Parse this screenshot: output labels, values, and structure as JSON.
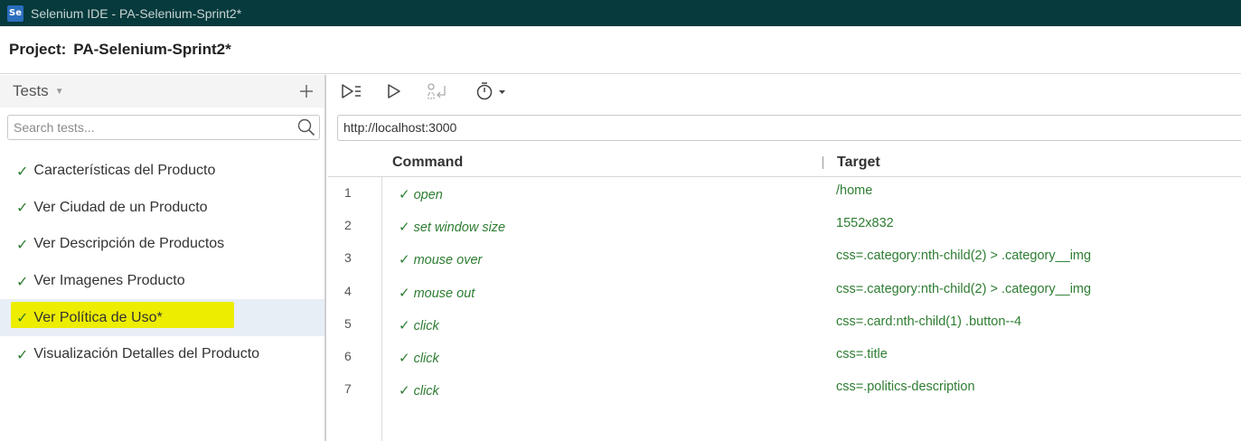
{
  "window": {
    "logo": "Se",
    "title": "Selenium IDE - PA-Selenium-Sprint2*"
  },
  "project": {
    "label": "Project:",
    "name": "PA-Selenium-Sprint2*"
  },
  "sidebar": {
    "title": "Tests",
    "add_icon": "plus-icon",
    "search_placeholder": "Search tests...",
    "check_mark": "✓",
    "tests": [
      {
        "label": "Características del Producto",
        "status": "passed"
      },
      {
        "label": "Ver Ciudad de un Producto",
        "status": "passed"
      },
      {
        "label": "Ver Descripción de Productos",
        "status": "passed"
      },
      {
        "label": "Ver Imagenes Producto",
        "status": "passed"
      },
      {
        "label": "Ver Política de Uso*",
        "status": "passed",
        "selected": true,
        "highlight_color": "#eded00"
      },
      {
        "label": "Visualización Detalles del Producto",
        "status": "passed"
      }
    ]
  },
  "toolbar": {
    "buttons": [
      "run-all-tests-icon",
      "run-current-test-icon",
      "record-icon",
      "timer-icon"
    ]
  },
  "url": "http://localhost:3000",
  "table": {
    "col_command": "Command",
    "col_target": "Target",
    "check_mark": "✓",
    "rows": [
      {
        "num": "1",
        "command": "open",
        "target": "/home"
      },
      {
        "num": "2",
        "command": "set window size",
        "target": "1552x832"
      },
      {
        "num": "3",
        "command": "mouse over",
        "target": "css=.category:nth-child(2) > .category__img"
      },
      {
        "num": "4",
        "command": "mouse out",
        "target": "css=.category:nth-child(2) > .category__img"
      },
      {
        "num": "5",
        "command": "click",
        "target": "css=.card:nth-child(1) .button--4"
      },
      {
        "num": "6",
        "command": "click",
        "target": "css=.title"
      },
      {
        "num": "7",
        "command": "click",
        "target": "css=.politics-description"
      }
    ]
  },
  "colors": {
    "titlebar": "#063a3c",
    "passed": "#2e7d32",
    "selected_row": "#e8eef5"
  }
}
